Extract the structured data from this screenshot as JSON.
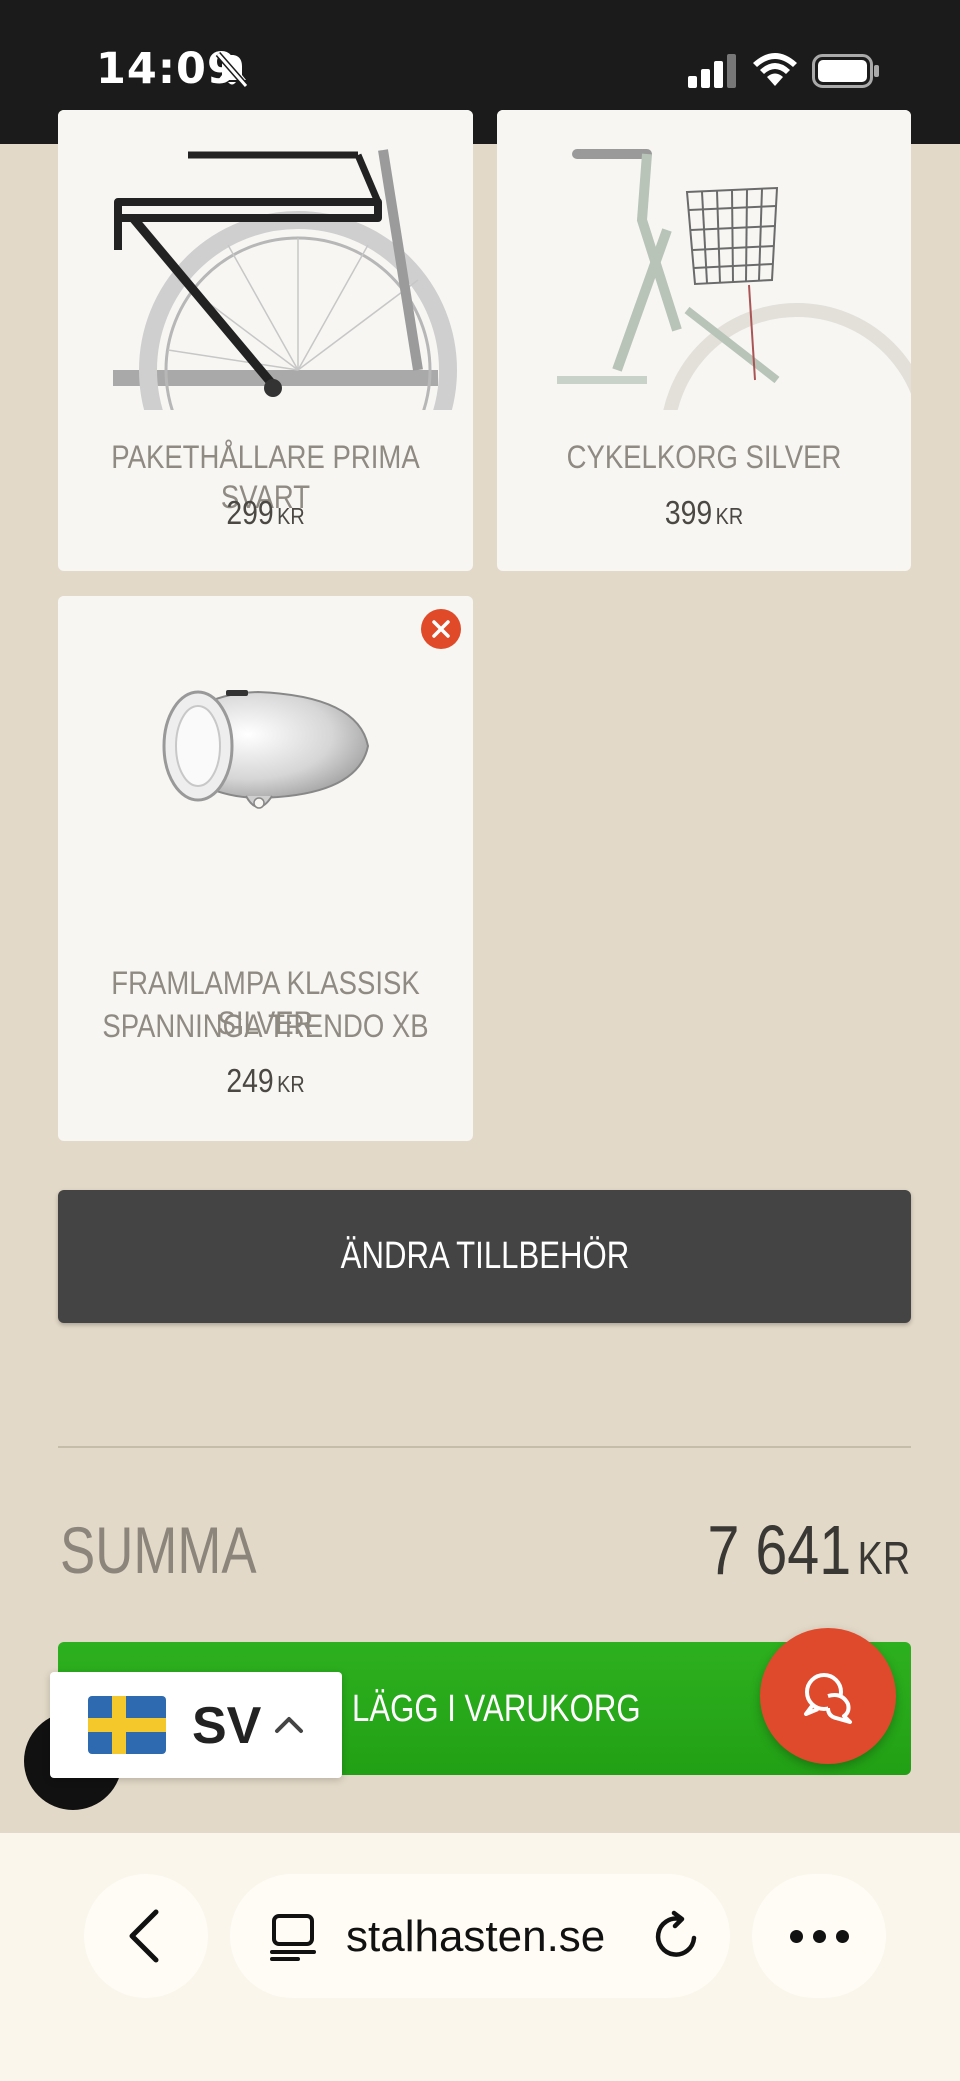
{
  "status_bar": {
    "time": "14:09"
  },
  "products": [
    {
      "name": "PAKETHÅLLARE PRIMA SVART",
      "price": "299",
      "currency": "KR"
    },
    {
      "name": "CYKELKORG SILVER",
      "price": "399",
      "currency": "KR"
    },
    {
      "name_line1": "FRAMLAMPA KLASSISK SILVER",
      "name_line2": "SPANNINGA TRENDO XB",
      "price": "249",
      "currency": "KR"
    }
  ],
  "change_accessories_label": "ÄNDRA TILLBEHÖR",
  "summary": {
    "label": "SUMMA",
    "amount": "7 641",
    "currency": "KR"
  },
  "add_to_cart_label": "LÄGG I VARUKORG",
  "language": {
    "code": "SV"
  },
  "browser": {
    "url": "stalhasten.se"
  },
  "colors": {
    "accent_green": "#22a015",
    "accent_red": "#e04a2c",
    "background": "#e3d9c8"
  }
}
